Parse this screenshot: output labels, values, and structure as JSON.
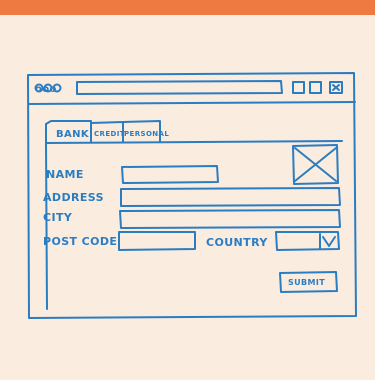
{
  "app": {
    "window_controls_left": "ooo",
    "title_bar_input": "",
    "title_bar_buttons": [
      "minimize",
      "maximize",
      "close"
    ]
  },
  "tabs": [
    {
      "label": "BANK"
    },
    {
      "label": "CREDIT"
    },
    {
      "label": "PERSONAL"
    }
  ],
  "form": {
    "name_label": "NAME",
    "address_label": "ADDRESS",
    "city_label": "CITY",
    "post_code_label": "POST CODE",
    "country_label": "COUNTRY",
    "submit_label": "SUBMIT"
  },
  "colors": {
    "background": "#fbece0",
    "accent": "#ee7a41",
    "ink": "#2b7dc2"
  }
}
